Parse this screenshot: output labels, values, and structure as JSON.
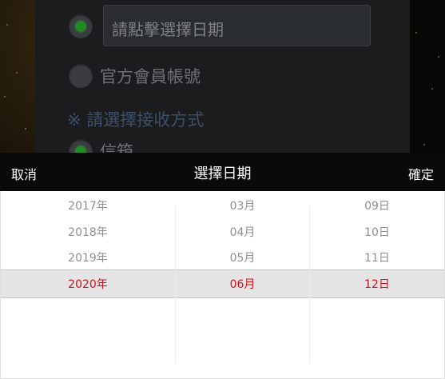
{
  "form": {
    "date_placeholder": "請點擊選擇日期",
    "option_official_account": "官方會員帳號",
    "delivery_note": "※ 請選擇接收方式",
    "option_mailbox": "信箱"
  },
  "picker": {
    "cancel_label": "取消",
    "title": "選擇日期",
    "confirm_label": "確定",
    "years": [
      "2017年",
      "2018年",
      "2019年",
      "2020年"
    ],
    "months": [
      "03月",
      "04月",
      "05月",
      "06月"
    ],
    "days": [
      "09日",
      "10日",
      "11日",
      "12日"
    ],
    "selected": {
      "year": "2020年",
      "month": "06月",
      "day": "12日"
    }
  },
  "colors": {
    "selected_text": "#d0121b",
    "radio_on": "#1e8e1e",
    "header_bg": "#0a0a0a"
  }
}
